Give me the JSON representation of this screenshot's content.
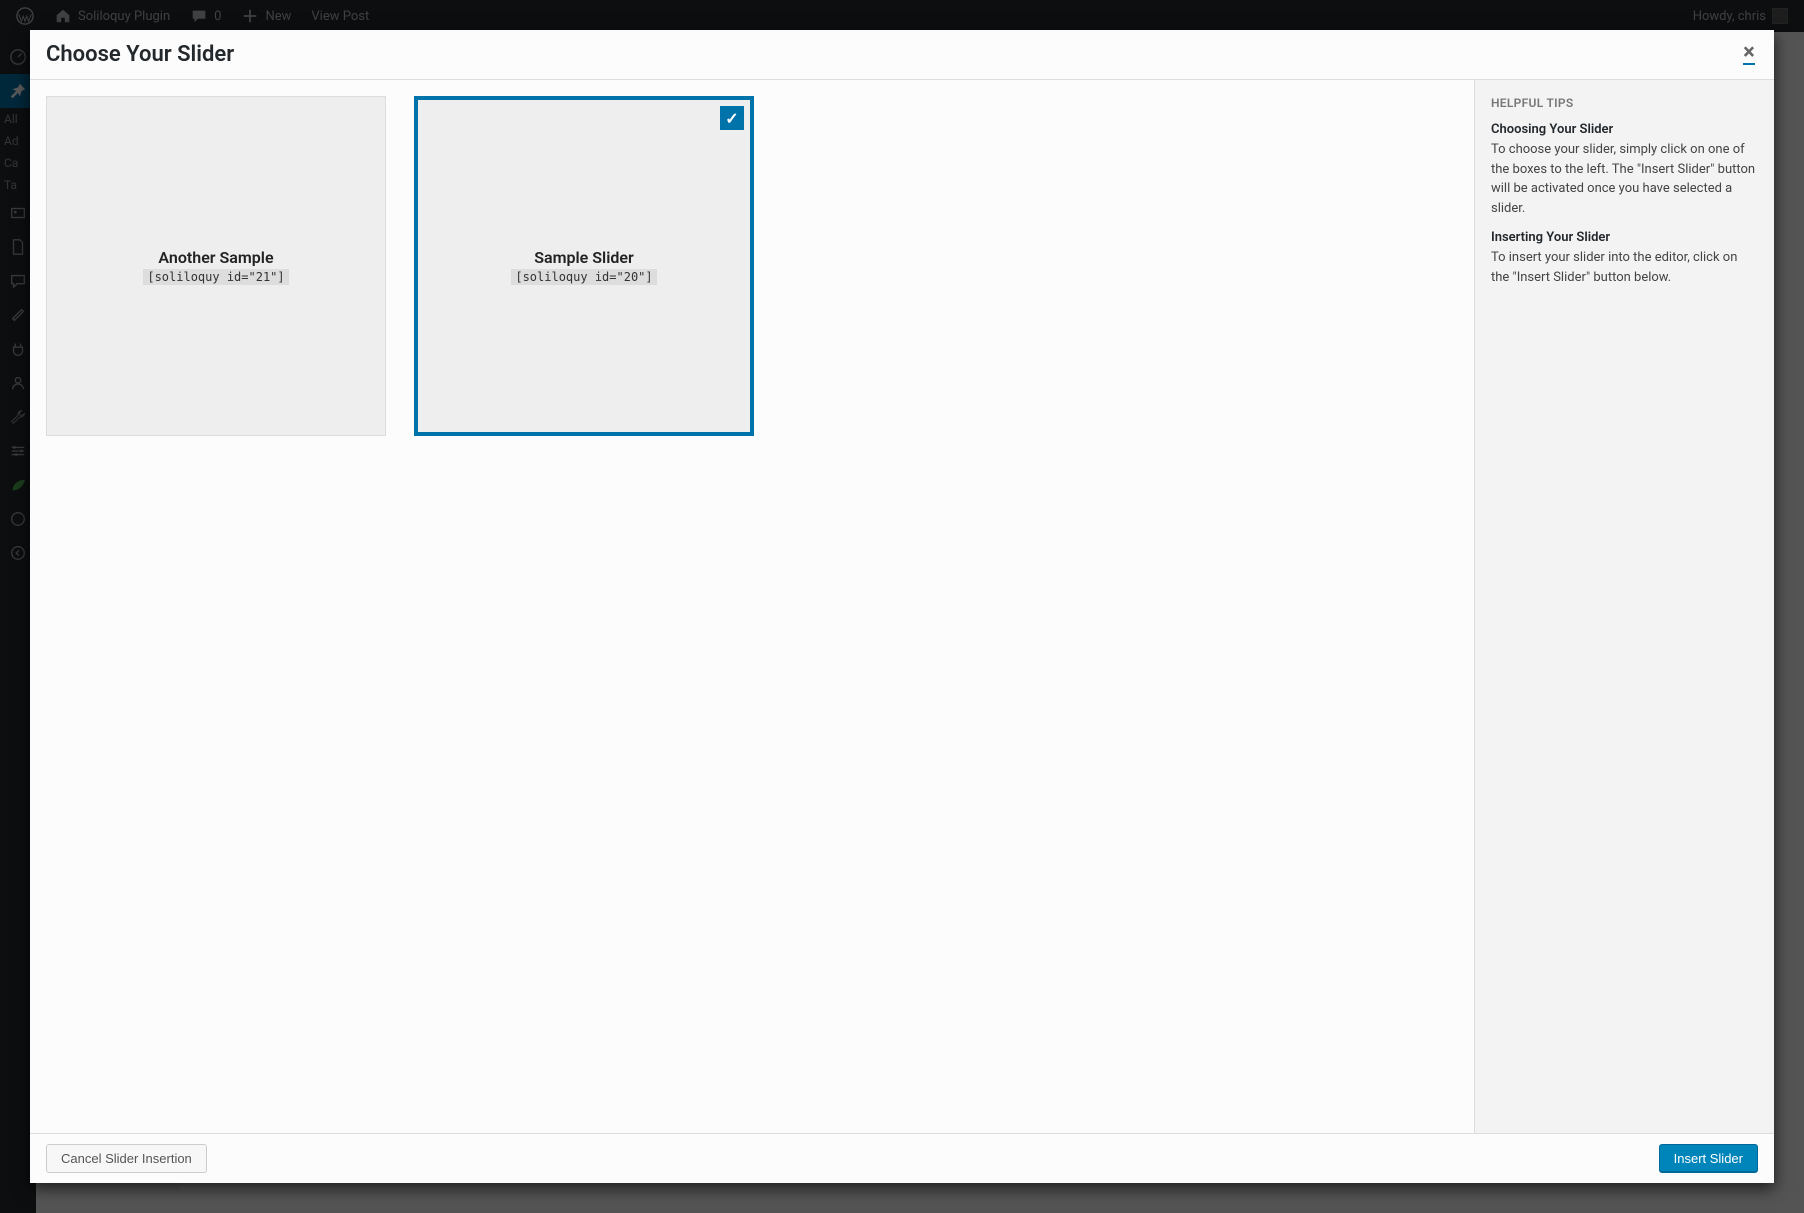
{
  "adminbar": {
    "site_name": "Soliloquy Plugin",
    "comment_count": "0",
    "new_label": "New",
    "view_label": "View Post",
    "greeting": "Howdy, chris"
  },
  "sidebar_text": {
    "item0": "All",
    "item1": "Ad",
    "item2": "Ca",
    "item3": "Ta"
  },
  "modal": {
    "title": "Choose Your Slider",
    "close_glyph": "×",
    "sliders": [
      {
        "name": "Another Sample",
        "shortcode": "[soliloquy id=\"21\"]",
        "selected": false
      },
      {
        "name": "Sample Slider",
        "shortcode": "[soliloquy id=\"20\"]",
        "selected": true
      }
    ],
    "check_glyph": "✓",
    "help": {
      "heading": "HELPFUL TIPS",
      "s1_title": "Choosing Your Slider",
      "s1_body": "To choose your slider, simply click on one of the boxes to the left. The \"Insert Slider\" button will be activated once you have selected a slider.",
      "s2_title": "Inserting Your Slider",
      "s2_body": "To insert your slider into the editor, click on the \"Insert Slider\" button below."
    },
    "footer": {
      "cancel": "Cancel Slider Insertion",
      "insert": "Insert Slider"
    }
  }
}
